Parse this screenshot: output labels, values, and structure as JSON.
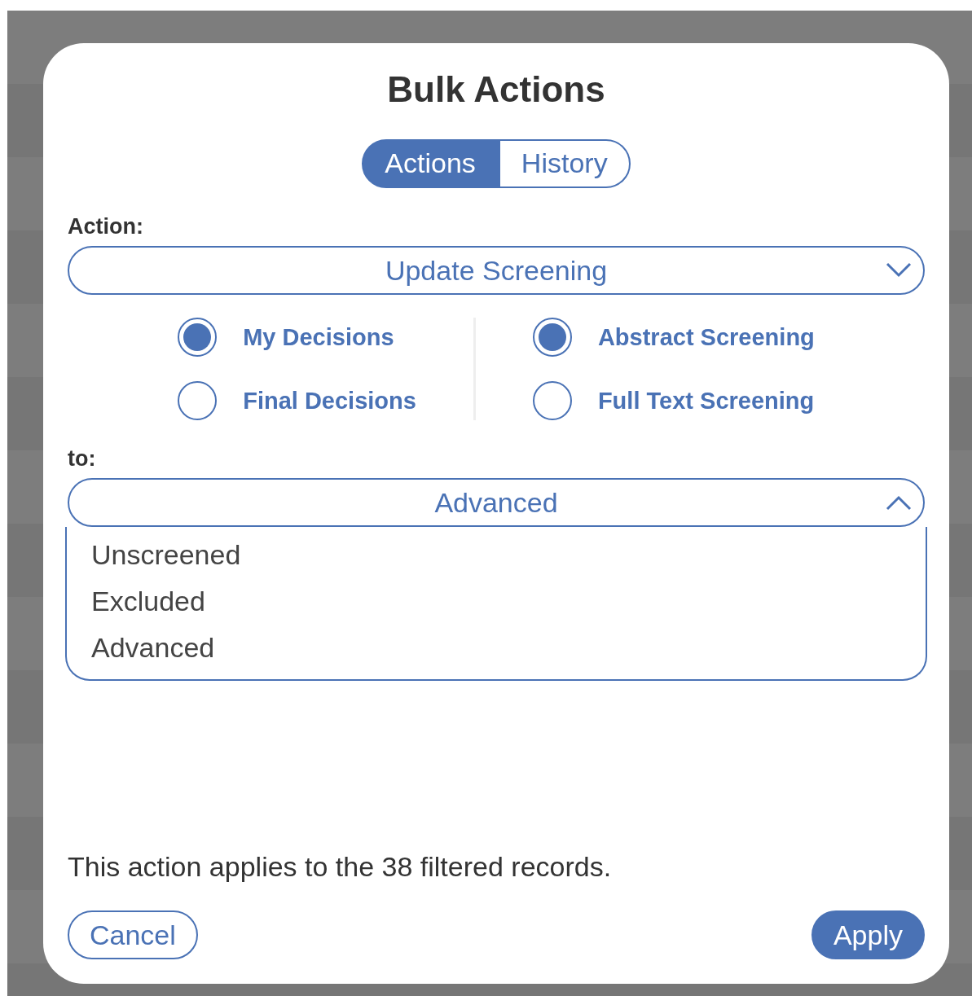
{
  "dialog": {
    "title": "Bulk Actions",
    "tabs": [
      {
        "label": "Actions",
        "selected": true
      },
      {
        "label": "History",
        "selected": false
      }
    ],
    "action_label": "Action:",
    "action_select": {
      "value": "Update Screening",
      "expanded": false
    },
    "decision_options": [
      {
        "label": "My Decisions",
        "selected": true
      },
      {
        "label": "Final Decisions",
        "selected": false
      }
    ],
    "stage_options": [
      {
        "label": "Abstract Screening",
        "selected": true
      },
      {
        "label": "Full Text Screening",
        "selected": false
      }
    ],
    "to_label": "to:",
    "to_select": {
      "value": "Advanced",
      "expanded": true,
      "options": [
        "Unscreened",
        "Excluded",
        "Advanced"
      ]
    },
    "note": "This action applies to the 38 filtered records.",
    "buttons": [
      {
        "label": "Cancel",
        "kind": "secondary"
      },
      {
        "label": "Apply",
        "kind": "primary"
      }
    ]
  }
}
